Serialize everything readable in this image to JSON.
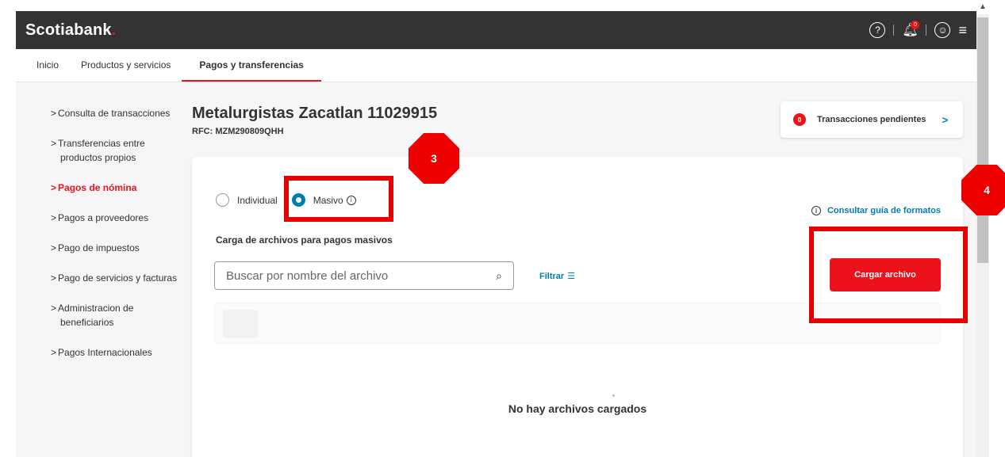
{
  "header": {
    "logo": "Scotiabank",
    "logo_dot": ".",
    "notif_count": "0"
  },
  "nav": [
    {
      "label": "Inicio"
    },
    {
      "label": "Productos y servicios"
    },
    {
      "label": "Pagos y transferencias"
    }
  ],
  "sidebar": {
    "items": [
      {
        "line1": "Consulta de transacciones",
        "line2": ""
      },
      {
        "line1": "Transferencias entre",
        "line2": "productos propios"
      },
      {
        "line1": "Pagos de nómina",
        "line2": ""
      },
      {
        "line1": "Pagos a proveedores",
        "line2": ""
      },
      {
        "line1": "Pago de impuestos",
        "line2": ""
      },
      {
        "line1": "Pago de servicios y facturas",
        "line2": ""
      },
      {
        "line1": "Administracion de",
        "line2": "beneficiarios"
      },
      {
        "line1": "Pagos Internacionales",
        "line2": ""
      }
    ]
  },
  "main": {
    "title": "Metalurgistas Zacatlan 11029915",
    "rfc": "RFC: MZM290809QHH",
    "pending": {
      "count": "0",
      "label": "Transacciones pendientes"
    },
    "radio_individual": "Individual",
    "radio_masivo": "Masivo",
    "guide_link": "Consultar guía de formatos",
    "upload_title": "Carga de archivos para pagos masivos",
    "search_placeholder": "Buscar por nombre del archivo",
    "filter_label": "Filtrar",
    "upload_button": "Cargar archivo",
    "empty_message": "No hay archivos cargados"
  },
  "annotations": {
    "step3": "3",
    "step4": "4",
    "color": "#ee0000"
  },
  "colors": {
    "brand_red": "#ec111a",
    "link_blue": "#007eab",
    "header_bg": "#333333"
  }
}
